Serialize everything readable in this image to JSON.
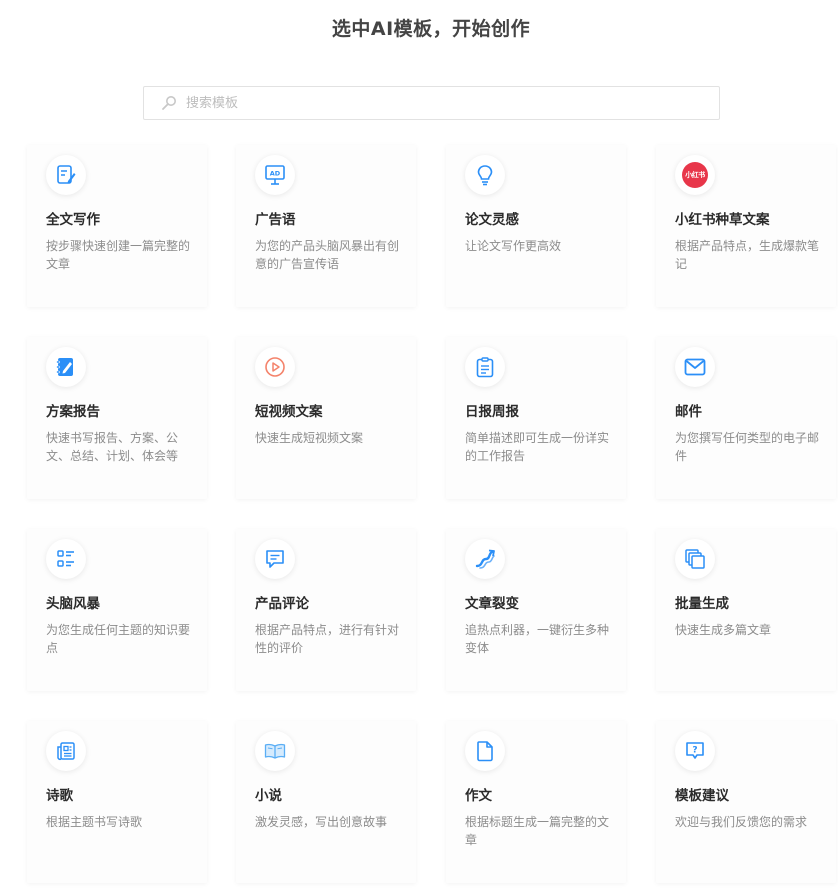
{
  "header": {
    "title": "选中AI模板，开始创作"
  },
  "search": {
    "placeholder": "搜索模板",
    "icon": "search-icon"
  },
  "accent_color": "#1e9bf0",
  "templates": [
    {
      "title": "全文写作",
      "desc": "按步骤快速创建一篇完整的文章",
      "icon": "edit-document-icon"
    },
    {
      "title": "广告语",
      "desc": "为您的产品头脑风暴出有创意的广告宣传语",
      "icon": "ad-board-icon"
    },
    {
      "title": "论文灵感",
      "desc": "让论文写作更高效",
      "icon": "lightbulb-icon"
    },
    {
      "title": "小红书种草文案",
      "desc": "根据产品特点，生成爆款笔记",
      "icon": "xiaohongshu-logo-icon",
      "icon_text": "小红书"
    },
    {
      "title": "方案报告",
      "desc": "快速书写报告、方案、公文、总结、计划、体会等",
      "icon": "notebook-pen-icon"
    },
    {
      "title": "短视频文案",
      "desc": "快速生成短视频文案",
      "icon": "video-play-icon"
    },
    {
      "title": "日报周报",
      "desc": "简单描述即可生成一份详实的工作报告",
      "icon": "clipboard-icon"
    },
    {
      "title": "邮件",
      "desc": "为您撰写任何类型的电子邮件",
      "icon": "mail-icon"
    },
    {
      "title": "头脑风暴",
      "desc": "为您生成任何主题的知识要点",
      "icon": "list-icon"
    },
    {
      "title": "产品评论",
      "desc": "根据产品特点，进行有针对性的评价",
      "icon": "chat-bubble-icon"
    },
    {
      "title": "文章裂变",
      "desc": "追热点利器，一键衍生多种变体",
      "icon": "split-arrow-icon"
    },
    {
      "title": "批量生成",
      "desc": "快速生成多篇文章",
      "icon": "stacked-pages-icon"
    },
    {
      "title": "诗歌",
      "desc": "根据主题书写诗歌",
      "icon": "newspaper-icon"
    },
    {
      "title": "小说",
      "desc": "激发灵感，写出创意故事",
      "icon": "open-book-icon"
    },
    {
      "title": "作文",
      "desc": "根据标题生成一篇完整的文章",
      "icon": "file-icon"
    },
    {
      "title": "模板建议",
      "desc": "欢迎与我们反馈您的需求",
      "icon": "question-chat-icon"
    }
  ]
}
